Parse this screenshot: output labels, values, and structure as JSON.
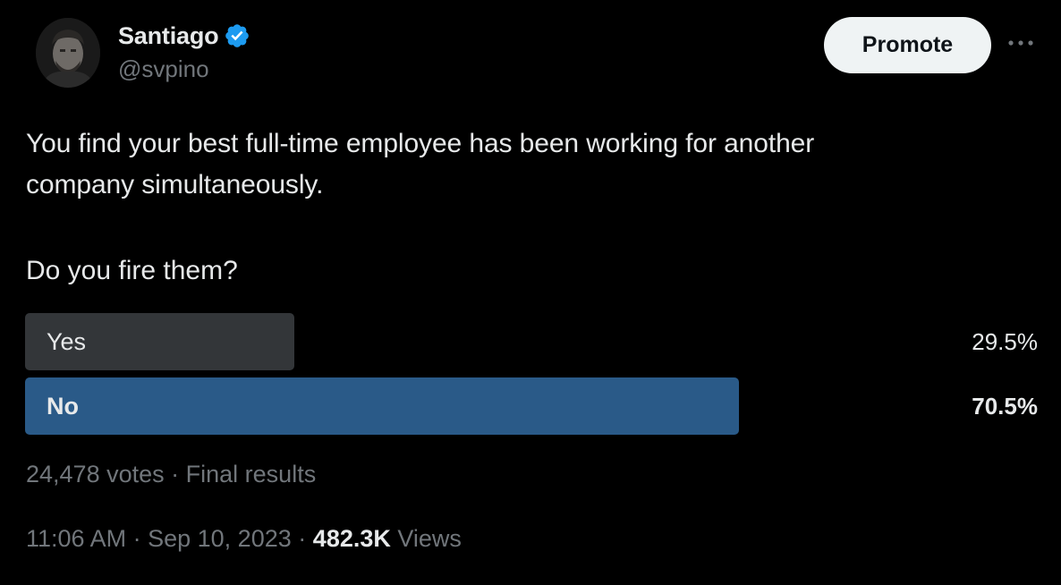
{
  "author": {
    "display_name": "Santiago",
    "handle": "@svpino",
    "verified_icon": "verified-badge-icon",
    "verified_color": "#1d9bf0"
  },
  "actions": {
    "promote_label": "Promote",
    "more_icon": "more-horizontal-icon"
  },
  "tweet": {
    "text": "You find your best full-time employee has been working for another\ncompany simultaneously.",
    "question": "Do you fire them?"
  },
  "poll": {
    "options": [
      {
        "label": "Yes",
        "percent": "29.5%",
        "value": 29.5,
        "color": "#333639"
      },
      {
        "label": "No",
        "percent": "70.5%",
        "value": 70.5,
        "color": "#2a5a88"
      }
    ],
    "votes": "24,478 votes",
    "separator": "·",
    "status": "Final results"
  },
  "meta": {
    "time": "11:06 AM",
    "date": "Sep 10, 2023",
    "separator": "·",
    "views_count": "482.3K",
    "views_label": "Views"
  },
  "colors": {
    "background": "#000000",
    "text_primary": "#e7e9ea",
    "text_secondary": "#71767b",
    "accent": "#1d9bf0"
  }
}
